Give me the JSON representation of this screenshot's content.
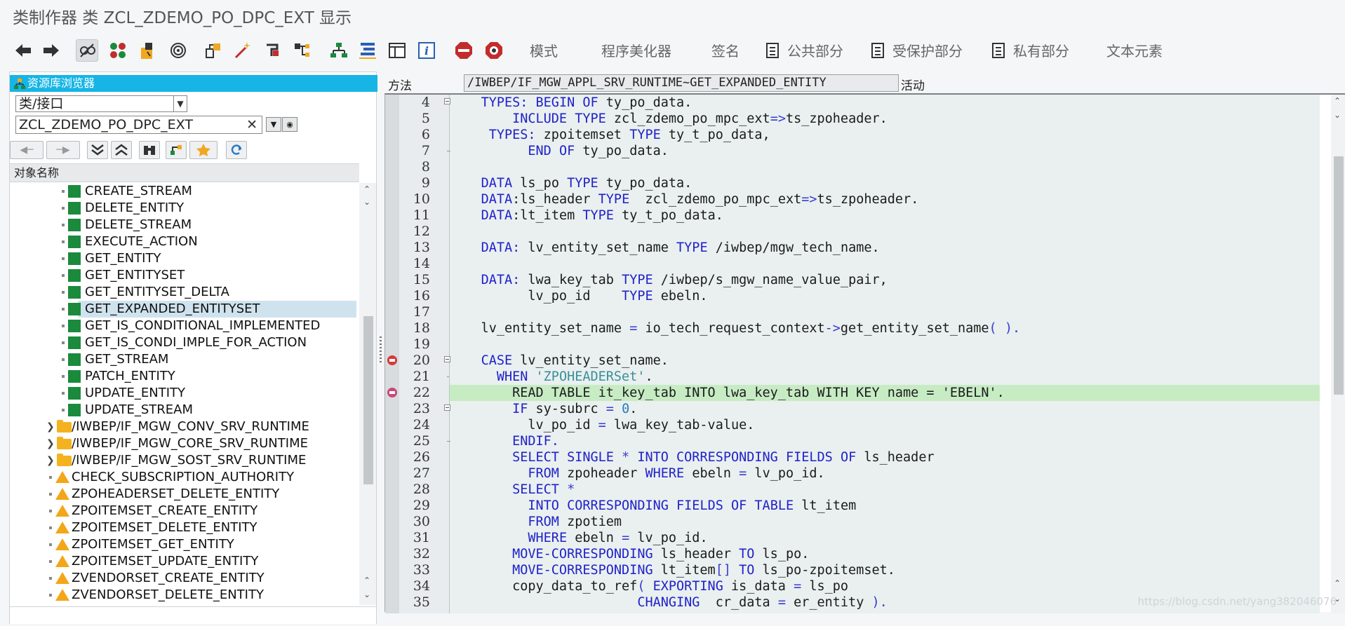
{
  "window": {
    "title": "类制作器 类 ZCL_ZDEMO_PO_DPC_EXT 显示"
  },
  "toolbar": {
    "buttons": [
      "back-icon",
      "forward-icon",
      "display-change-icon",
      "activate-icon",
      "check-icon",
      "where-used-icon",
      "object-list-icon",
      "wand-icon",
      "enhancement-icon",
      "hierarchy-icon",
      "tree-icon",
      "tree2-icon",
      "layout-icon",
      "info-icon",
      "breakpoint-icon",
      "external-breakpoint-icon"
    ],
    "pattern": "模式",
    "pretty_printer": "程序美化器",
    "signature": "签名",
    "public_section": "公共部分",
    "protected_section": "受保护部分",
    "private_section": "私有部分",
    "text_elements": "文本元素"
  },
  "navigator": {
    "header": "资源库浏览器",
    "object_type": "类/接口",
    "object_name": "ZCL_ZDEMO_PO_DPC_EXT",
    "column_header": "对象名称",
    "items": [
      {
        "label": "CREATE_STREAM",
        "kind": "method"
      },
      {
        "label": "DELETE_ENTITY",
        "kind": "method"
      },
      {
        "label": "DELETE_STREAM",
        "kind": "method"
      },
      {
        "label": "EXECUTE_ACTION",
        "kind": "method"
      },
      {
        "label": "GET_ENTITY",
        "kind": "method"
      },
      {
        "label": "GET_ENTITYSET",
        "kind": "method"
      },
      {
        "label": "GET_ENTITYSET_DELTA",
        "kind": "method"
      },
      {
        "label": "GET_EXPANDED_ENTITYSET",
        "kind": "method",
        "selected": true
      },
      {
        "label": "GET_IS_CONDITIONAL_IMPLEMENTED",
        "kind": "method"
      },
      {
        "label": "GET_IS_CONDI_IMPLE_FOR_ACTION",
        "kind": "method"
      },
      {
        "label": "GET_STREAM",
        "kind": "method"
      },
      {
        "label": "PATCH_ENTITY",
        "kind": "method"
      },
      {
        "label": "UPDATE_ENTITY",
        "kind": "method"
      },
      {
        "label": "UPDATE_STREAM",
        "kind": "method"
      },
      {
        "label": "/IWBEP/IF_MGW_CONV_SRV_RUNTIME",
        "kind": "folder"
      },
      {
        "label": "/IWBEP/IF_MGW_CORE_SRV_RUNTIME",
        "kind": "folder"
      },
      {
        "label": "/IWBEP/IF_MGW_SOST_SRV_RUNTIME",
        "kind": "folder"
      },
      {
        "label": "CHECK_SUBSCRIPTION_AUTHORITY",
        "kind": "warn"
      },
      {
        "label": "ZPOHEADERSET_DELETE_ENTITY",
        "kind": "warn"
      },
      {
        "label": "ZPOITEMSET_CREATE_ENTITY",
        "kind": "warn"
      },
      {
        "label": "ZPOITEMSET_DELETE_ENTITY",
        "kind": "warn"
      },
      {
        "label": "ZPOITEMSET_GET_ENTITY",
        "kind": "warn"
      },
      {
        "label": "ZPOITEMSET_UPDATE_ENTITY",
        "kind": "warn"
      },
      {
        "label": "ZVENDORSET_CREATE_ENTITY",
        "kind": "warn"
      },
      {
        "label": "ZVENDORSET_DELETE_ENTITY",
        "kind": "warn"
      }
    ]
  },
  "method_bar": {
    "label": "方法",
    "method": "/IWBEP/IF_MGW_APPL_SRV_RUNTIME~GET_EXPANDED_ENTITY",
    "status": "活动"
  },
  "editor": {
    "lines": [
      {
        "n": "4",
        "fold": "box",
        "t": [
          [
            "    "
          ],
          [
            "TYPES:",
            "kw"
          ],
          [
            " "
          ],
          [
            "BEGIN",
            "kw"
          ],
          [
            " "
          ],
          [
            "OF",
            "kw"
          ],
          [
            " ty_po_data."
          ]
        ]
      },
      {
        "n": "5",
        "t": [
          [
            "        "
          ],
          [
            "INCLUDE",
            "kw"
          ],
          [
            " "
          ],
          [
            "TYPE",
            "kw"
          ],
          [
            " zcl_zdemo_po_mpc_ext"
          ],
          [
            "=>",
            "op"
          ],
          [
            "ts_zpoheader."
          ]
        ]
      },
      {
        "n": "6",
        "t": [
          [
            "     "
          ],
          [
            "TYPES:",
            "kw"
          ],
          [
            " zpoitemset "
          ],
          [
            "TYPE",
            "kw"
          ],
          [
            " ty_t_po_data,"
          ]
        ]
      },
      {
        "n": "7",
        "fold": "tick",
        "t": [
          [
            "          "
          ],
          [
            "END",
            "kw"
          ],
          [
            " "
          ],
          [
            "OF",
            "kw"
          ],
          [
            " ty_po_data."
          ]
        ]
      },
      {
        "n": "8",
        "t": [
          [
            ""
          ]
        ]
      },
      {
        "n": "9",
        "t": [
          [
            "    "
          ],
          [
            "DATA",
            "kw"
          ],
          [
            " ls_po "
          ],
          [
            "TYPE",
            "kw"
          ],
          [
            " ty_po_data."
          ]
        ]
      },
      {
        "n": "10",
        "t": [
          [
            "    "
          ],
          [
            "DATA",
            "kw"
          ],
          [
            ":ls_header "
          ],
          [
            "TYPE",
            "kw"
          ],
          [
            "  zcl_zdemo_po_mpc_ext"
          ],
          [
            "=>",
            "op"
          ],
          [
            "ts_zpoheader."
          ]
        ]
      },
      {
        "n": "11",
        "t": [
          [
            "    "
          ],
          [
            "DATA",
            "kw"
          ],
          [
            ":lt_item "
          ],
          [
            "TYPE",
            "kw"
          ],
          [
            " ty_t_po_data."
          ]
        ]
      },
      {
        "n": "12",
        "t": [
          [
            ""
          ]
        ]
      },
      {
        "n": "13",
        "t": [
          [
            "    "
          ],
          [
            "DATA:",
            "kw"
          ],
          [
            " lv_entity_set_name "
          ],
          [
            "TYPE",
            "kw"
          ],
          [
            " /iwbep/mgw_tech_name."
          ]
        ]
      },
      {
        "n": "14",
        "t": [
          [
            ""
          ]
        ]
      },
      {
        "n": "15",
        "t": [
          [
            "    "
          ],
          [
            "DATA:",
            "kw"
          ],
          [
            " lwa_key_tab "
          ],
          [
            "TYPE",
            "kw"
          ],
          [
            " /iwbep/s_mgw_name_value_pair,"
          ]
        ]
      },
      {
        "n": "16",
        "t": [
          [
            "          lv_po_id    "
          ],
          [
            "TYPE",
            "kw"
          ],
          [
            " ebeln."
          ]
        ]
      },
      {
        "n": "17",
        "t": [
          [
            ""
          ]
        ]
      },
      {
        "n": "18",
        "t": [
          [
            "    lv_entity_set_name "
          ],
          [
            "=",
            "op"
          ],
          [
            " io_tech_request_context"
          ],
          [
            "->",
            "op"
          ],
          [
            "get_entity_set_name"
          ],
          [
            "( ).",
            "op"
          ]
        ]
      },
      {
        "n": "19",
        "t": [
          [
            ""
          ]
        ]
      },
      {
        "n": "20",
        "fold": "box",
        "bp": "stop",
        "t": [
          [
            "    "
          ],
          [
            "CASE",
            "kw"
          ],
          [
            " lv_entity_set_name."
          ]
        ]
      },
      {
        "n": "21",
        "fold": "dot",
        "t": [
          [
            "      "
          ],
          [
            "WHEN",
            "kw"
          ],
          [
            " "
          ],
          [
            "'ZPOHEADERSet'",
            "str"
          ],
          [
            "."
          ]
        ]
      },
      {
        "n": "22",
        "hl": true,
        "bp": "ext",
        "t": [
          [
            "        READ TABLE it_key_tab INTO lwa_key_tab WITH KEY name = 'EBELN'."
          ]
        ]
      },
      {
        "n": "23",
        "fold": "box",
        "t": [
          [
            "        "
          ],
          [
            "IF",
            "kw"
          ],
          [
            " sy-subrc "
          ],
          [
            "=",
            "op"
          ],
          [
            " "
          ],
          [
            "0",
            "num"
          ],
          [
            "."
          ]
        ]
      },
      {
        "n": "24",
        "t": [
          [
            "          lv_po_id "
          ],
          [
            "=",
            "op"
          ],
          [
            " lwa_key_tab-value."
          ]
        ]
      },
      {
        "n": "25",
        "fold": "tick",
        "t": [
          [
            "        "
          ],
          [
            "ENDIF.",
            "kw"
          ]
        ]
      },
      {
        "n": "26",
        "t": [
          [
            "        "
          ],
          [
            "SELECT",
            "kw"
          ],
          [
            " "
          ],
          [
            "SINGLE",
            "kw"
          ],
          [
            " "
          ],
          [
            "*",
            "op"
          ],
          [
            " "
          ],
          [
            "INTO",
            "kw"
          ],
          [
            " "
          ],
          [
            "CORRESPONDING",
            "kw"
          ],
          [
            " "
          ],
          [
            "FIELDS",
            "kw"
          ],
          [
            " "
          ],
          [
            "OF",
            "kw"
          ],
          [
            " ls_header"
          ]
        ]
      },
      {
        "n": "27",
        "t": [
          [
            "          "
          ],
          [
            "FROM",
            "kw"
          ],
          [
            " zpoheader "
          ],
          [
            "WHERE",
            "kw"
          ],
          [
            " ebeln "
          ],
          [
            "=",
            "op"
          ],
          [
            " lv_po_id."
          ]
        ]
      },
      {
        "n": "28",
        "t": [
          [
            "        "
          ],
          [
            "SELECT",
            "kw"
          ],
          [
            " "
          ],
          [
            "*",
            "op"
          ]
        ]
      },
      {
        "n": "29",
        "t": [
          [
            "          "
          ],
          [
            "INTO",
            "kw"
          ],
          [
            " "
          ],
          [
            "CORRESPONDING",
            "kw"
          ],
          [
            " "
          ],
          [
            "FIELDS",
            "kw"
          ],
          [
            " "
          ],
          [
            "OF",
            "kw"
          ],
          [
            " "
          ],
          [
            "TABLE",
            "kw"
          ],
          [
            " lt_item"
          ]
        ]
      },
      {
        "n": "30",
        "t": [
          [
            "          "
          ],
          [
            "FROM",
            "kw"
          ],
          [
            " zpotiem"
          ]
        ]
      },
      {
        "n": "31",
        "t": [
          [
            "          "
          ],
          [
            "WHERE",
            "kw"
          ],
          [
            " ebeln "
          ],
          [
            "=",
            "op"
          ],
          [
            " lv_po_id."
          ]
        ]
      },
      {
        "n": "32",
        "t": [
          [
            "        "
          ],
          [
            "MOVE-CORRESPONDING",
            "kw"
          ],
          [
            " ls_header "
          ],
          [
            "TO",
            "kw"
          ],
          [
            " ls_po."
          ]
        ]
      },
      {
        "n": "33",
        "t": [
          [
            "        "
          ],
          [
            "MOVE-CORRESPONDING",
            "kw"
          ],
          [
            " lt_item"
          ],
          [
            "[]",
            "op"
          ],
          [
            " "
          ],
          [
            "TO",
            "kw"
          ],
          [
            " ls_po-zpoitemset."
          ]
        ]
      },
      {
        "n": "34",
        "t": [
          [
            "        copy_data_to_ref"
          ],
          [
            "(",
            "op"
          ],
          [
            " "
          ],
          [
            "EXPORTING",
            "kw"
          ],
          [
            " is_data "
          ],
          [
            "=",
            "op"
          ],
          [
            " ls_po"
          ]
        ]
      },
      {
        "n": "35",
        "t": [
          [
            "                        "
          ],
          [
            "CHANGING",
            "kw"
          ],
          [
            "  cr_data "
          ],
          [
            "=",
            "op"
          ],
          [
            " er_entity "
          ],
          [
            ").",
            "op"
          ]
        ]
      }
    ]
  },
  "watermark": "https://blog.csdn.net/yang382046076",
  "colors": {
    "accent": "#16b5e6",
    "highlight_line": "#c7ecc4",
    "keyword": "#2121c9",
    "string": "#3a8f9a"
  }
}
